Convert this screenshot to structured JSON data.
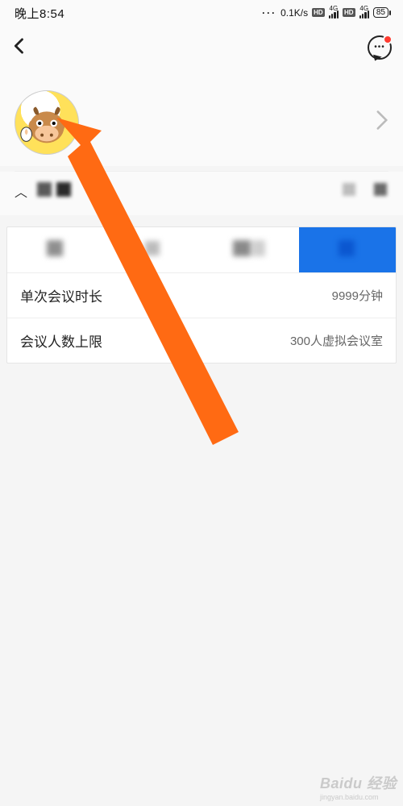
{
  "status": {
    "time": "晚上8:54",
    "net_speed": "0.1K/s",
    "net_label_4g": "4G",
    "battery": "85"
  },
  "header": {},
  "profile": {},
  "tabs": {
    "active_index": 3
  },
  "details": {
    "duration_label": "单次会议时长",
    "duration_value": "9999分钟",
    "capacity_label": "会议人数上限",
    "capacity_value": "300人虚拟会议室"
  },
  "watermark": {
    "brand": "Baidu 经验",
    "url": "jingyan.baidu.com"
  }
}
